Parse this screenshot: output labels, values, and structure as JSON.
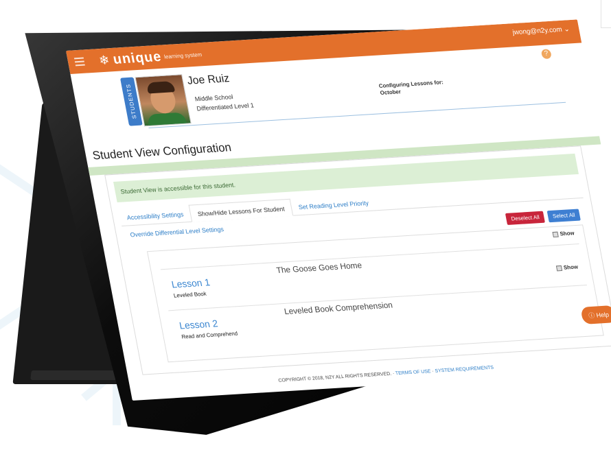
{
  "app": {
    "brand": "unique",
    "brand_sub": "learning system",
    "user_email": "jwong@n2y.com",
    "help_label": "Help"
  },
  "student": {
    "tab_label": "STUDENTS",
    "name": "Joe Ruiz",
    "school": "Middle School",
    "level": "Differentiated Level 1",
    "config_label": "Configuring Lessons for:",
    "config_month": "October"
  },
  "page": {
    "title": "Student View Configuration",
    "alert": "Student View is accessible for this student."
  },
  "tabs": [
    {
      "label": "Accessibility Settings"
    },
    {
      "label": "Show/Hide Lessons For Student"
    },
    {
      "label": "Set Reading Level Priority"
    }
  ],
  "override_link": "Override Differential Level Settings",
  "buttons": {
    "deselect_all": "Deselect All",
    "select_all": "Select All"
  },
  "show_label": "Show",
  "lessons": [
    {
      "number": "Lesson 1",
      "type": "Leveled Book",
      "title": "The Goose Goes Home"
    },
    {
      "number": "Lesson 2",
      "type": "Read and Comprehend",
      "title": "Leveled Book Comprehension"
    }
  ],
  "footer": {
    "copyright": "COPYRIGHT © 2018, N2Y ALL RIGHTS RESERVED. · ",
    "terms": "TERMS OF USE",
    "sep": " · ",
    "sysreq": "SYSTEM REQUIREMENTS"
  },
  "colors": {
    "header": "#e3702b",
    "link": "#2d7ec7",
    "deselect": "#c8253b",
    "select": "#3e7fd2"
  }
}
